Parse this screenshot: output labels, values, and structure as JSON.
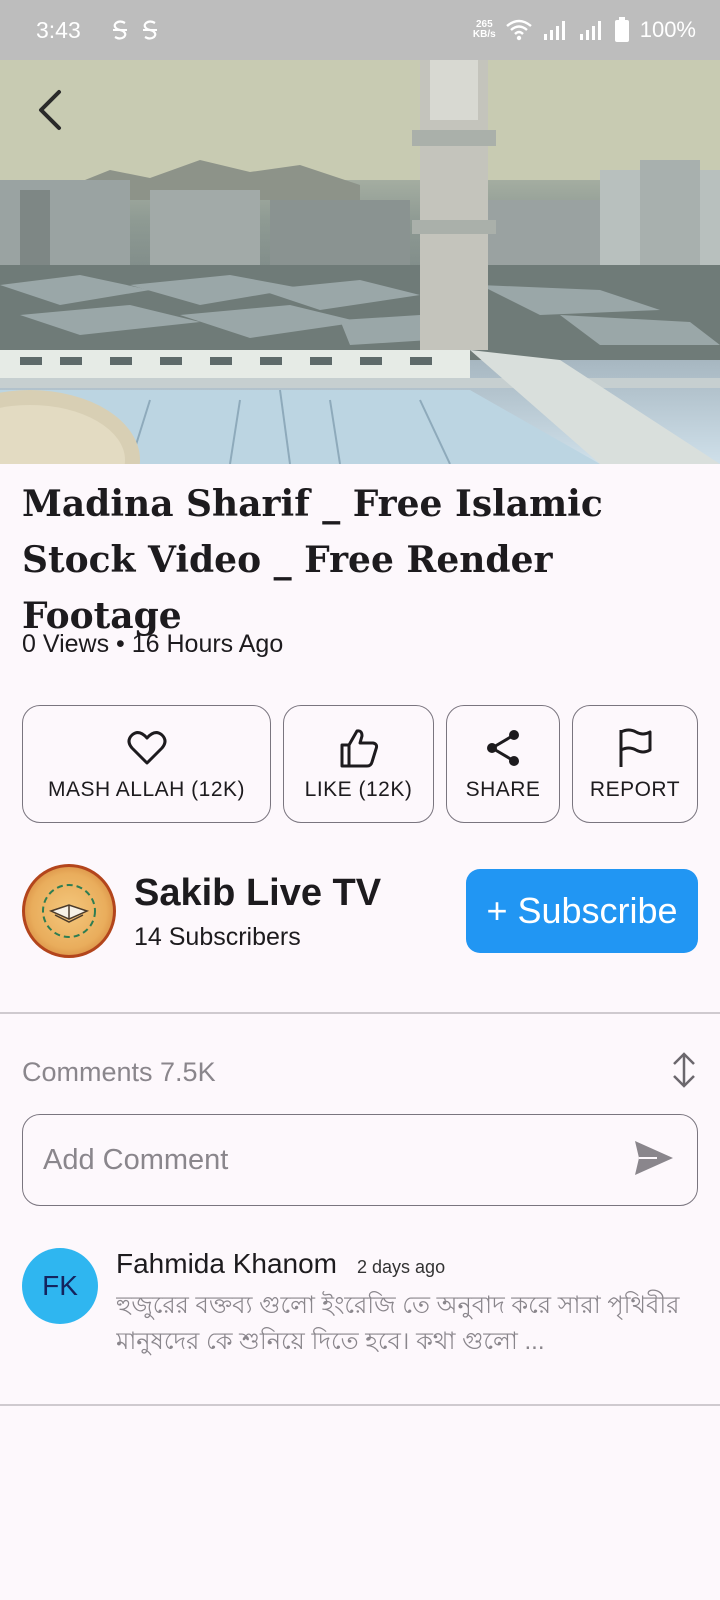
{
  "status_bar": {
    "time": "3:43",
    "net_speed_value": "265",
    "net_speed_unit": "KB/s",
    "battery": "100%"
  },
  "video": {
    "title": "Madina Sharif _ Free Islamic Stock Video _ Free Render Footage",
    "meta": "0 Views • 16 Hours Ago"
  },
  "actions": [
    {
      "label": "MASH ALLAH (12K)",
      "icon": "heart-icon"
    },
    {
      "label": "LIKE (12K)",
      "icon": "thumbs-up-icon"
    },
    {
      "label": "SHARE",
      "icon": "share-icon"
    },
    {
      "label": "REPORT",
      "icon": "flag-icon"
    }
  ],
  "channel": {
    "name": "Sakib Live TV",
    "subscribers": "14 Subscribers",
    "subscribe_label": "+ Subscribe",
    "subscribe_color": "#2196f3"
  },
  "comments": {
    "label": "Comments 7.5K",
    "input_placeholder": "Add Comment",
    "items": [
      {
        "initials": "FK",
        "author": "Fahmida Khanom",
        "time": "2 days ago",
        "text": "হুজুরের বক্তব্য গুলো ইংরেজি তে অনুবাদ করে সারা পৃথিবীর মানুষদের কে শুনিয়ে দিতে হবে। কথা গুলো ...",
        "avatar_color": "#2fb6f0"
      }
    ]
  }
}
